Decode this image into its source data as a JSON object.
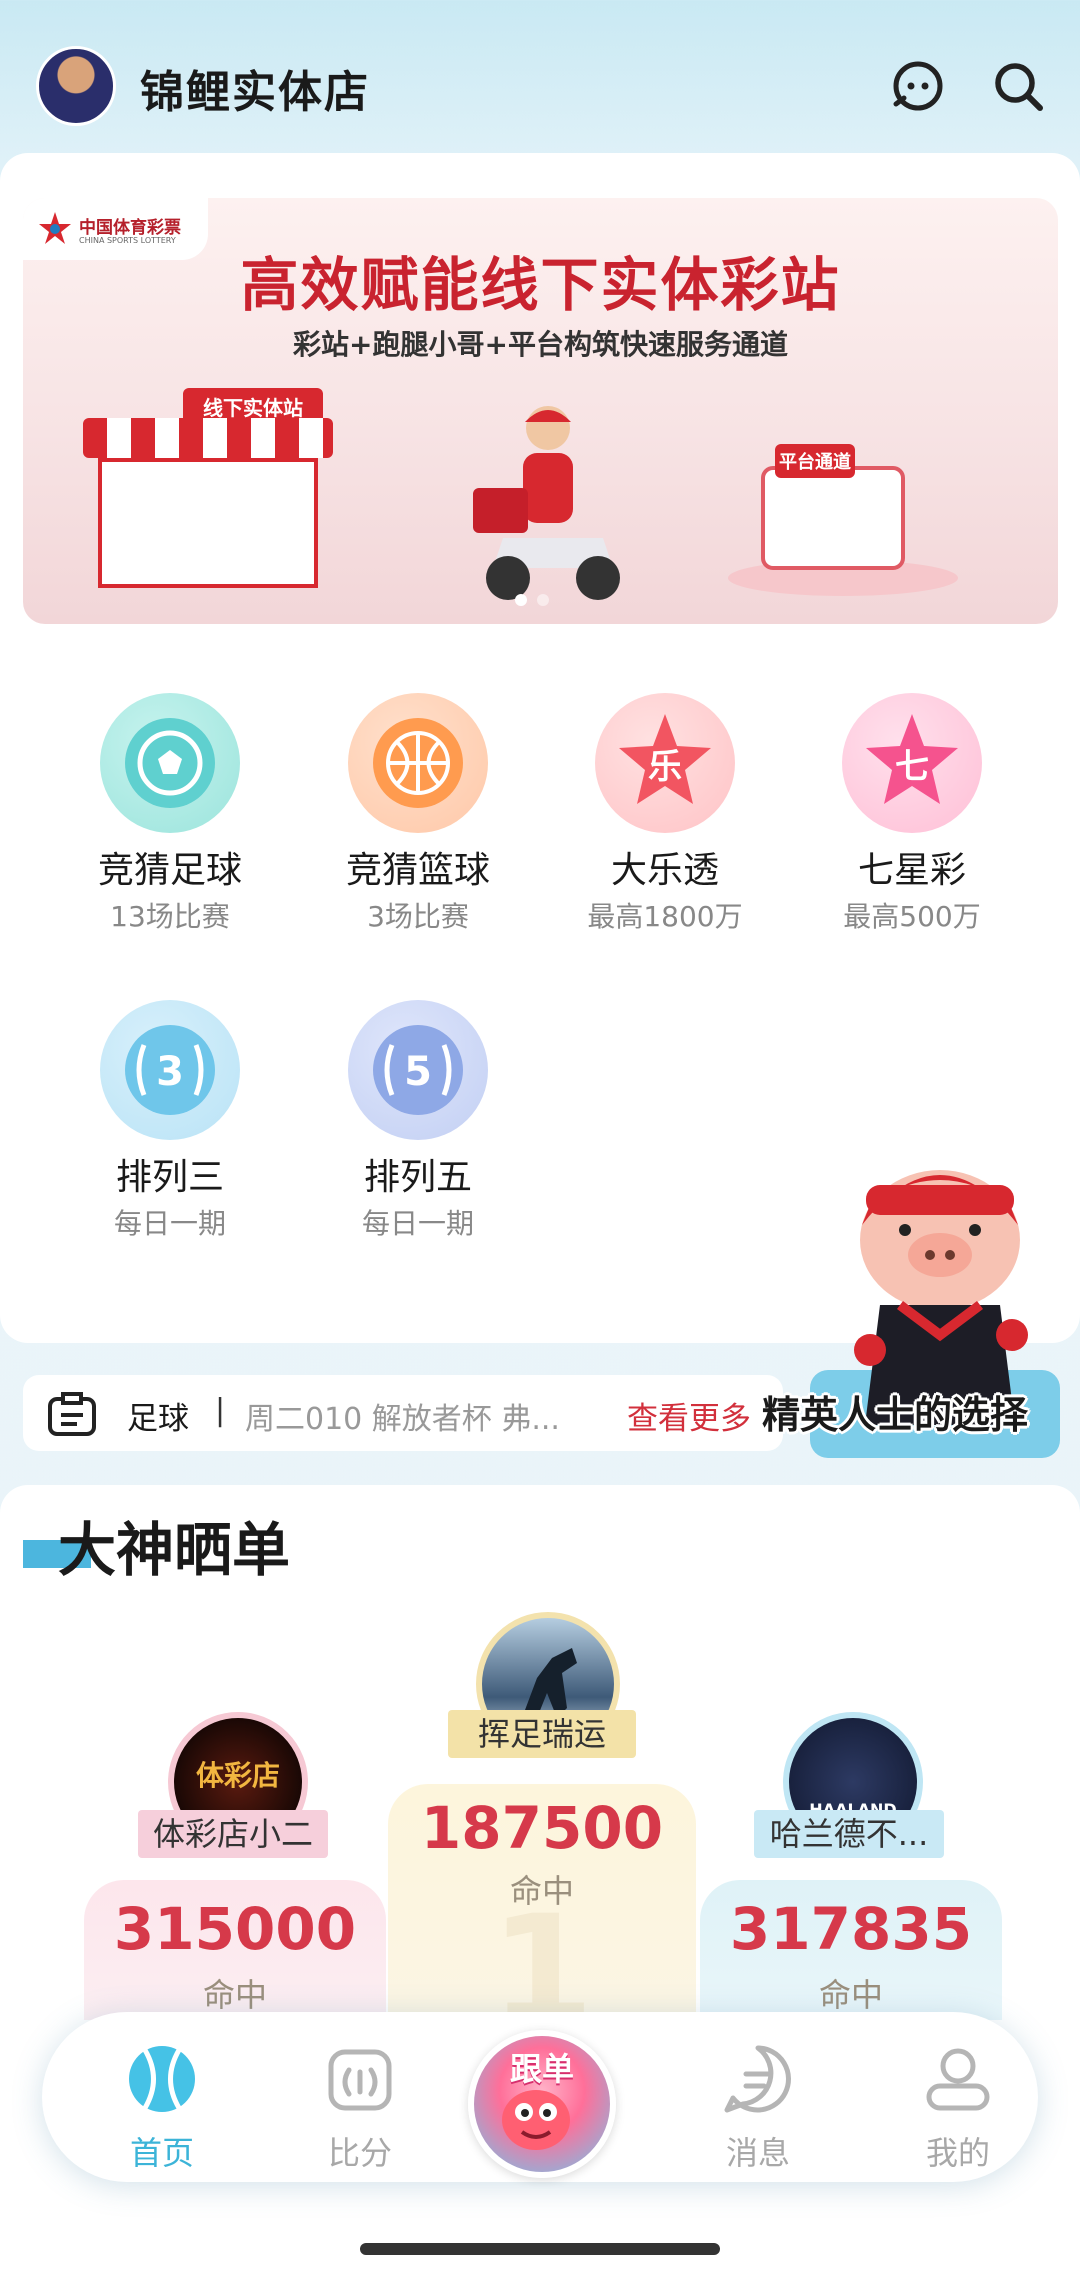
{
  "header": {
    "store_name": "锦鲤实体店"
  },
  "banner": {
    "logo_cn": "中国体育彩票",
    "logo_en": "CHINA SPORTS LOTTERY",
    "title": "高效赋能线下实体彩站",
    "subtitle": "彩站+跑腿小哥+平台构筑快速服务通道",
    "kiosk_sign": "线下实体站",
    "platform_sign": "平台通道"
  },
  "games": [
    {
      "name": "竞猜足球",
      "desc": "13场比赛",
      "icon": "soccer-icon"
    },
    {
      "name": "竞猜篮球",
      "desc": "3场比赛",
      "icon": "basketball-icon"
    },
    {
      "name": "大乐透",
      "desc": "最高1800万",
      "icon": "star-le-icon",
      "glyph": "乐"
    },
    {
      "name": "七星彩",
      "desc": "最高500万",
      "icon": "star-qi-icon",
      "glyph": "七"
    },
    {
      "name": "排列三",
      "desc": "每日一期",
      "icon": "pl3-icon",
      "glyph": "3"
    },
    {
      "name": "排列五",
      "desc": "每日一期",
      "icon": "pl5-icon",
      "glyph": "5"
    }
  ],
  "ticker": {
    "category": "足球",
    "separator": "|",
    "text": "周二010 解放者杯 弗...",
    "more": "查看更多"
  },
  "mascot": {
    "slogan": "精英人士的选择"
  },
  "showcase": {
    "title": "大神晒单",
    "label": "命中",
    "first": {
      "name": "挥足瑞运",
      "amount": "187500",
      "rank": "1"
    },
    "second": {
      "name": "体彩店小二",
      "amount": "315000",
      "avatar_text": "体彩店"
    },
    "third": {
      "name": "哈兰德不...",
      "amount": "317835",
      "avatar_text": "HAALAND"
    }
  },
  "tabbar": {
    "home": "首页",
    "score": "比分",
    "follow": "跟单",
    "messages": "消息",
    "mine": "我的"
  },
  "colors": {
    "accent": "#3cb4d8",
    "brand_red": "#d2303c"
  }
}
